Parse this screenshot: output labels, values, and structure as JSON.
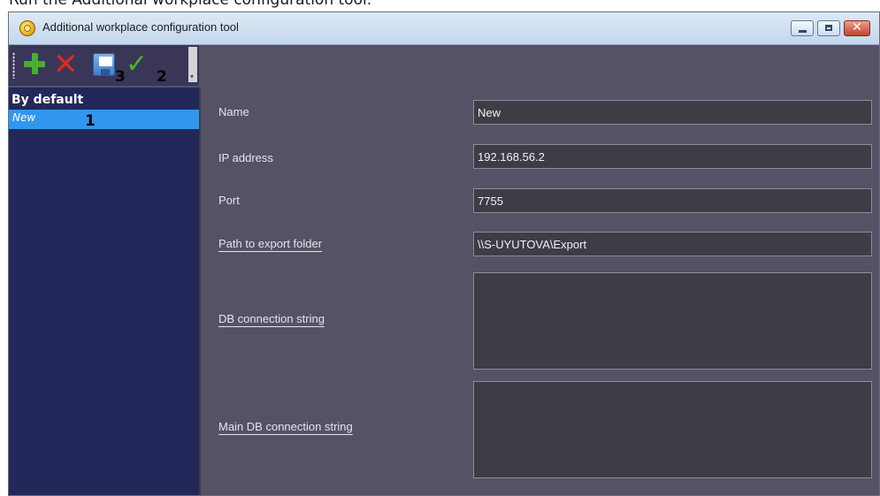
{
  "caption": "Run the Additional workplace configuration tool.",
  "window": {
    "title": "Additional workplace configuration tool",
    "buttons": {
      "close_symbol": "✕"
    }
  },
  "toolbar": {
    "items": [
      {
        "icon": "plus-icon",
        "badge": ""
      },
      {
        "icon": "delete-icon",
        "badge": ""
      },
      {
        "icon": "save-icon",
        "badge": "3"
      },
      {
        "icon": "check-icon",
        "badge": "2"
      }
    ],
    "delete_glyph": "✕",
    "check_glyph": "✓"
  },
  "sidebar": {
    "header": "By default",
    "items": [
      {
        "label": "New",
        "selected": true,
        "badge": "1"
      }
    ]
  },
  "form": {
    "name_label": "Name",
    "name_value": "New",
    "ip_label": "IP address",
    "ip_value": "192.168.56.2",
    "port_label": "Port",
    "port_value": "7755",
    "export_label": "Path to export folder",
    "export_value": "\\\\S-UYUTOVA\\Export",
    "db_label": "DB connection string",
    "db_value": "",
    "main_db_label": "Main DB connection string",
    "main_db_value": ""
  },
  "colors": {
    "panel": "#555266",
    "sidebar": "#22285a",
    "selection": "#3197ee",
    "field": "#3e3d46"
  }
}
